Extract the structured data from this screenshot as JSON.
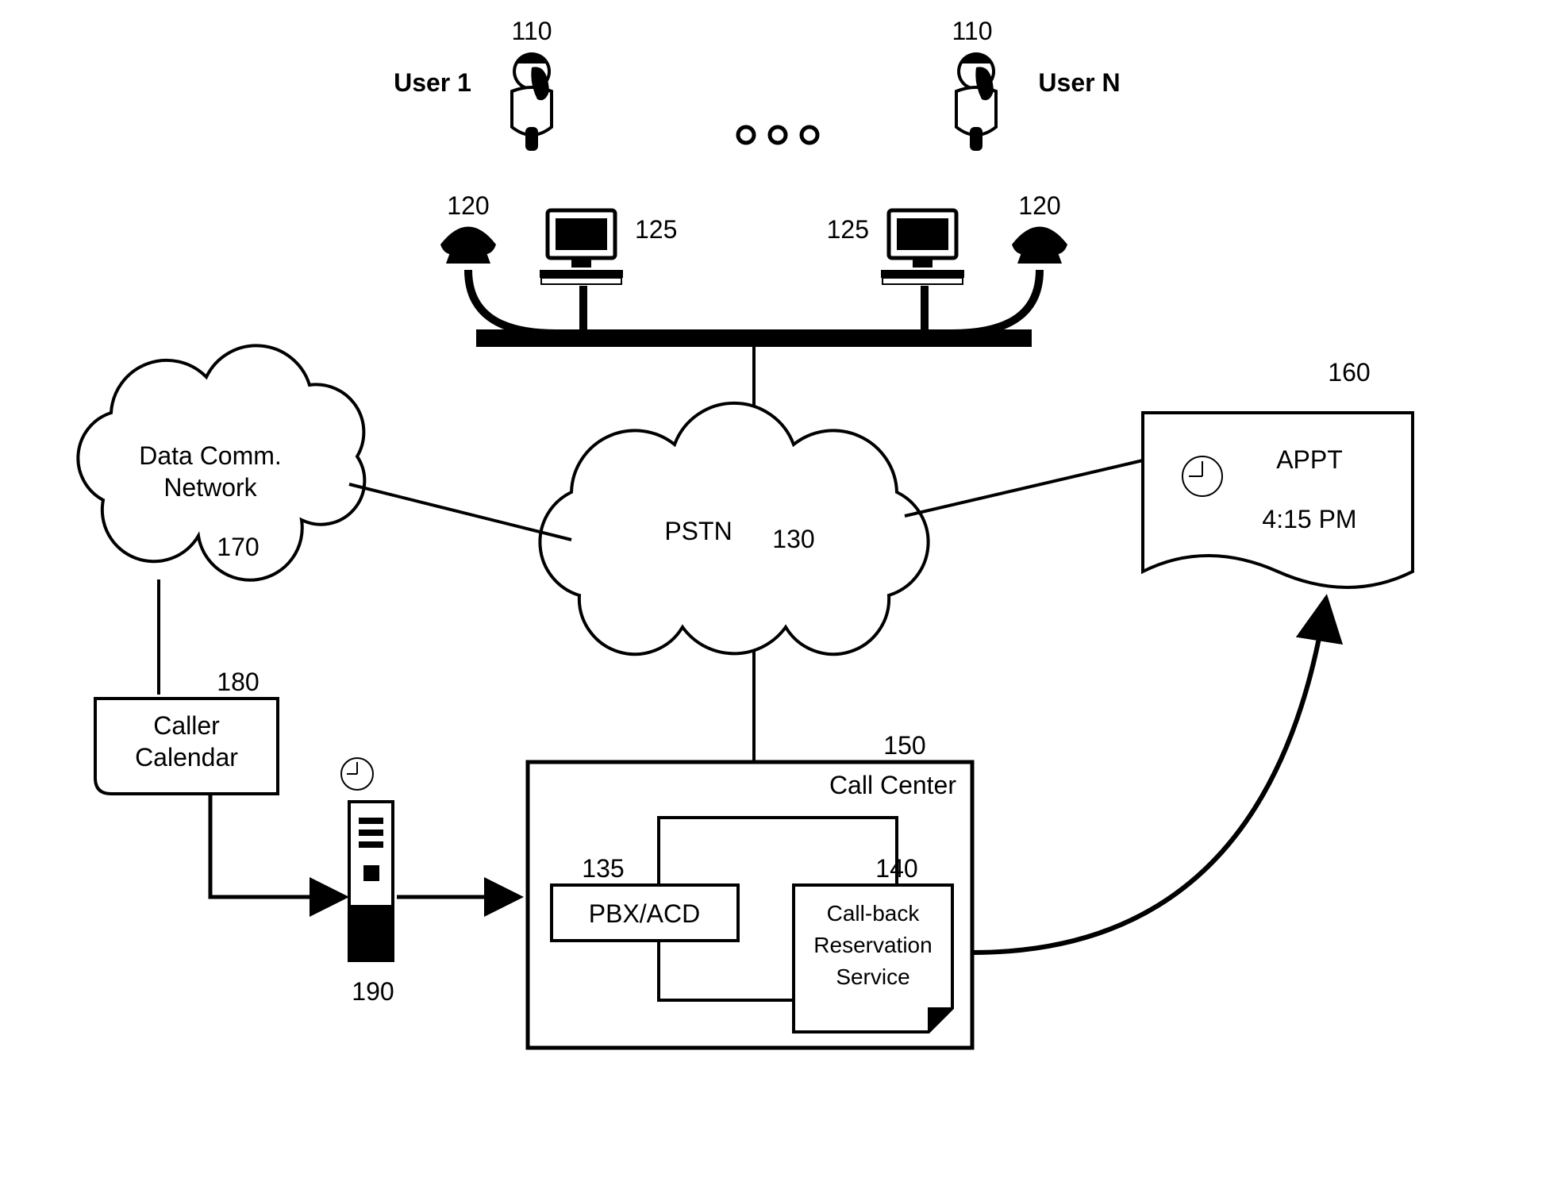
{
  "refs": {
    "user": "110",
    "phone": "120",
    "computer": "125",
    "pstn_ref": "130",
    "pbx_ref": "135",
    "callback_ref": "140",
    "callcenter_ref": "150",
    "appt_ref": "160",
    "datacomm_ref": "170",
    "calendar_ref": "180",
    "server_ref": "190"
  },
  "labels": {
    "user1": "User 1",
    "userN": "User N",
    "datacomm_l1": "Data Comm.",
    "datacomm_l2": "Network",
    "pstn": "PSTN",
    "calendar_l1": "Caller",
    "calendar_l2": "Calendar",
    "callcenter": "Call Center",
    "pbx": "PBX/ACD",
    "callback_l1": "Call-back",
    "callback_l2": "Reservation",
    "callback_l3": "Service",
    "appt_title": "APPT",
    "appt_time": "4:15 PM"
  }
}
